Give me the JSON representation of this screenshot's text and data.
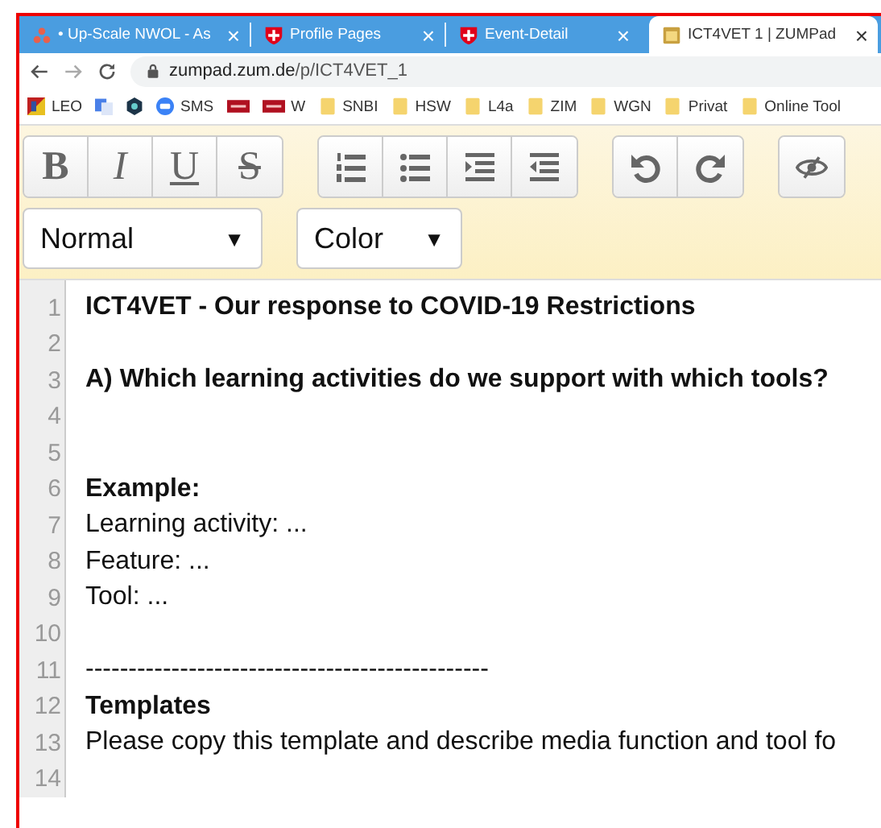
{
  "tabs": [
    {
      "title": "• Up-Scale NWOL - As",
      "kind": "dots",
      "close": "×",
      "selected": false
    },
    {
      "title": "Profile Pages",
      "kind": "shield",
      "close": "×",
      "selected": false
    },
    {
      "title": "Event-Detail",
      "kind": "shield",
      "close": "×",
      "selected": false
    },
    {
      "title": "ICT4VET 1 | ZUMPad",
      "kind": "pad",
      "close": "×",
      "selected": true
    }
  ],
  "address": {
    "host": "zumpad.zum.de",
    "path": "/p/ICT4VET_1"
  },
  "bookmarks": [
    {
      "label": "LEO",
      "kind": "leo"
    },
    {
      "kind": "translate"
    },
    {
      "kind": "hex"
    },
    {
      "label": "SMS",
      "kind": "sms"
    },
    {
      "kind": "srf"
    },
    {
      "label": "W",
      "kind": "srf"
    },
    {
      "label": "SNBI",
      "kind": "folder"
    },
    {
      "label": "HSW",
      "kind": "folder"
    },
    {
      "label": "L4a",
      "kind": "folder"
    },
    {
      "label": "ZIM",
      "kind": "folder"
    },
    {
      "label": "WGN",
      "kind": "folder"
    },
    {
      "label": "Privat",
      "kind": "folder"
    },
    {
      "label": "Online Tool",
      "kind": "folder"
    }
  ],
  "toolbar": [
    [
      {
        "kind": "bold",
        "glyph": "B"
      },
      {
        "kind": "italic",
        "glyph": "I"
      },
      {
        "kind": "underline",
        "glyph": "U"
      },
      {
        "kind": "strike",
        "glyph": "S"
      }
    ],
    [
      {
        "kind": "ol"
      },
      {
        "kind": "ul"
      },
      {
        "kind": "indent"
      },
      {
        "kind": "outdent"
      }
    ],
    [
      {
        "kind": "undo"
      },
      {
        "kind": "redo"
      }
    ],
    [
      {
        "kind": "eye"
      }
    ]
  ],
  "selects": [
    {
      "value": "Normal",
      "arrow": "▼"
    },
    {
      "value": "Color",
      "arrow": "▼"
    }
  ],
  "lines": [
    {
      "number": "1",
      "text": "ICT4VET - Our response to COVID-19 Restrictions",
      "bold": true
    },
    {
      "number": "2"
    },
    {
      "number": "3",
      "text": "A) Which learning activities do we support with which tools?",
      "bold": true
    },
    {
      "number": "4"
    },
    {
      "number": "5"
    },
    {
      "number": "6",
      "text": "Example:",
      "bold": true
    },
    {
      "number": "7",
      "text": "Learning activity: ...",
      "bold": false
    },
    {
      "number": "8",
      "text": "Feature: ...",
      "bold": false
    },
    {
      "number": "9",
      "text": "Tool: ...",
      "bold": false
    },
    {
      "number": "10"
    },
    {
      "number": "11",
      "text": "-----------------------------------------------",
      "bold": false
    },
    {
      "number": "12",
      "text": "Templates",
      "bold": true
    },
    {
      "number": "13",
      "text": "Please copy this template and describe media function and tool fo",
      "bold": false
    },
    {
      "number": "14"
    }
  ]
}
